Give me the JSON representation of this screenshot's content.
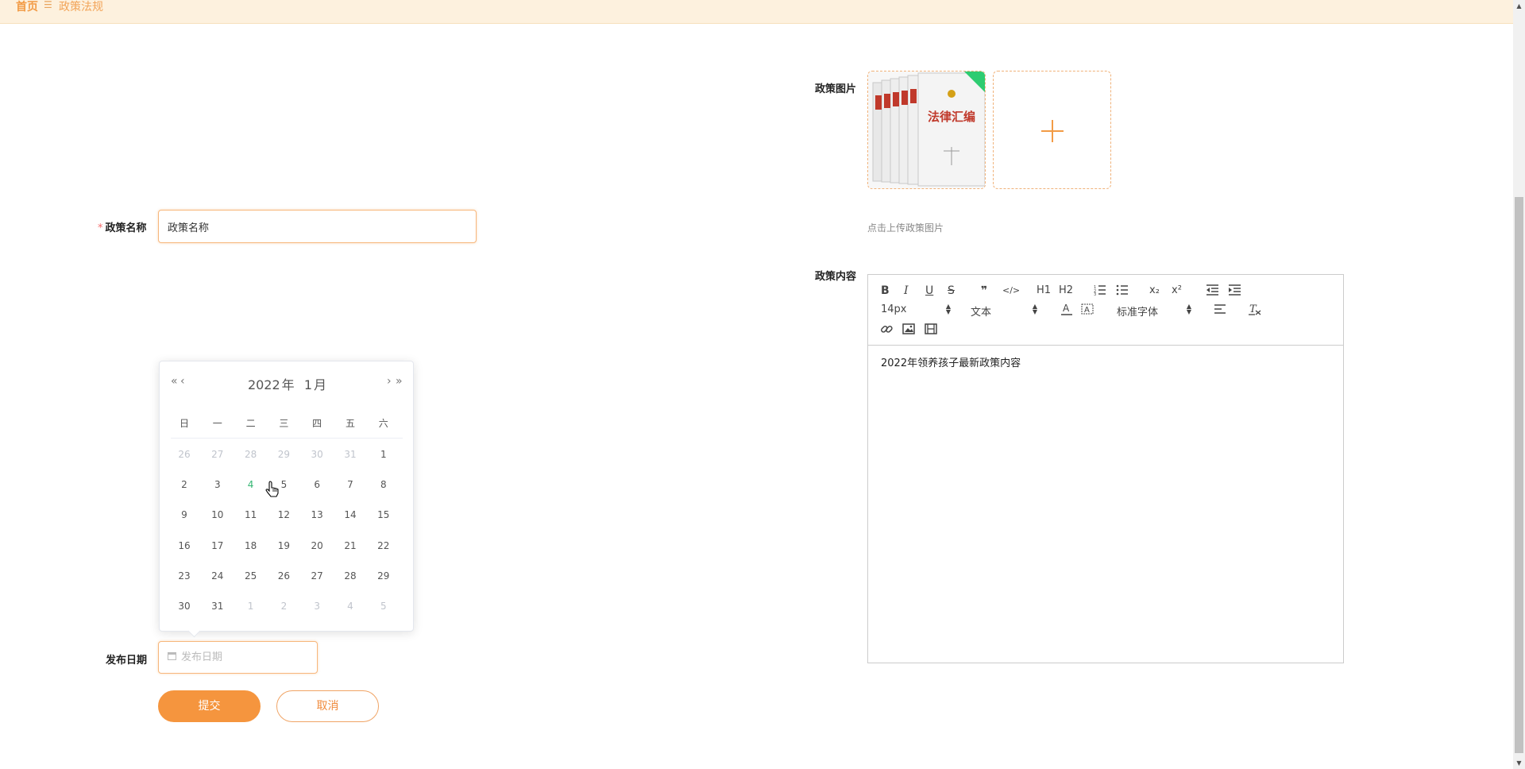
{
  "breadcrumb": {
    "home": "首页",
    "separator": "☰",
    "current": "政策法规"
  },
  "form": {
    "name": {
      "label": "政策名称",
      "required": "*",
      "value": "政策名称",
      "placeholder": "政策名称"
    },
    "date": {
      "label": "发布日期",
      "placeholder": "发布日期",
      "value": ""
    },
    "image": {
      "label": "政策图片",
      "tip": "点击上传政策图片",
      "image_text": "法律汇编"
    },
    "content": {
      "label": "政策内容",
      "text": "2022年领养孩子最新政策内容"
    },
    "submit_label": "提交",
    "cancel_label": "取消"
  },
  "calendar": {
    "year": "2022",
    "year_suffix": "年",
    "month": "1",
    "month_suffix": "月",
    "nav_prev_year": "«",
    "nav_prev_month": "‹",
    "nav_next_month": "›",
    "nav_next_year": "»",
    "weekdays": [
      "日",
      "一",
      "二",
      "三",
      "四",
      "五",
      "六"
    ],
    "weeks": [
      [
        {
          "d": "26",
          "m": true
        },
        {
          "d": "27",
          "m": true
        },
        {
          "d": "28",
          "m": true
        },
        {
          "d": "29",
          "m": true
        },
        {
          "d": "30",
          "m": true
        },
        {
          "d": "31",
          "m": true
        },
        {
          "d": "1"
        }
      ],
      [
        {
          "d": "2"
        },
        {
          "d": "3"
        },
        {
          "d": "4",
          "today": true
        },
        {
          "d": "5"
        },
        {
          "d": "6"
        },
        {
          "d": "7"
        },
        {
          "d": "8"
        }
      ],
      [
        {
          "d": "9"
        },
        {
          "d": "10"
        },
        {
          "d": "11"
        },
        {
          "d": "12"
        },
        {
          "d": "13"
        },
        {
          "d": "14"
        },
        {
          "d": "15"
        }
      ],
      [
        {
          "d": "16"
        },
        {
          "d": "17"
        },
        {
          "d": "18"
        },
        {
          "d": "19"
        },
        {
          "d": "20"
        },
        {
          "d": "21"
        },
        {
          "d": "22"
        }
      ],
      [
        {
          "d": "23"
        },
        {
          "d": "24"
        },
        {
          "d": "25"
        },
        {
          "d": "26"
        },
        {
          "d": "27"
        },
        {
          "d": "28"
        },
        {
          "d": "29"
        }
      ],
      [
        {
          "d": "30"
        },
        {
          "d": "31"
        },
        {
          "d": "1",
          "m": true
        },
        {
          "d": "2",
          "m": true
        },
        {
          "d": "3",
          "m": true
        },
        {
          "d": "4",
          "m": true
        },
        {
          "d": "5",
          "m": true
        }
      ]
    ]
  },
  "editor": {
    "toolbar": {
      "bold": "B",
      "italic": "I",
      "underline": "U",
      "strike": "S",
      "blockquote": "❞",
      "code": "</>",
      "h1": "H1",
      "h2": "H2",
      "x_sub": "x₂",
      "x_sup": "x²",
      "size": "14px",
      "header": "文本",
      "font": "标准字体"
    }
  },
  "colors": {
    "accent": "#f5953e",
    "breadcrumb_bg": "#fdf1de",
    "today": "#34b572",
    "badge": "#2ecc71"
  },
  "icons": {
    "breadcrumb_separator": "menu-icon",
    "calendar": "calendar-icon",
    "upload": "plus-icon",
    "toolbar": [
      "bold-icon",
      "italic-icon",
      "underline-icon",
      "strike-icon",
      "quote-icon",
      "code-icon",
      "h1-icon",
      "h2-icon",
      "ordered-list-icon",
      "bullet-list-icon",
      "subscript-icon",
      "superscript-icon",
      "indent-decrease-icon",
      "indent-increase-icon",
      "text-color-icon",
      "background-color-icon",
      "align-icon",
      "clear-format-icon",
      "link-icon",
      "image-icon",
      "video-icon"
    ]
  }
}
